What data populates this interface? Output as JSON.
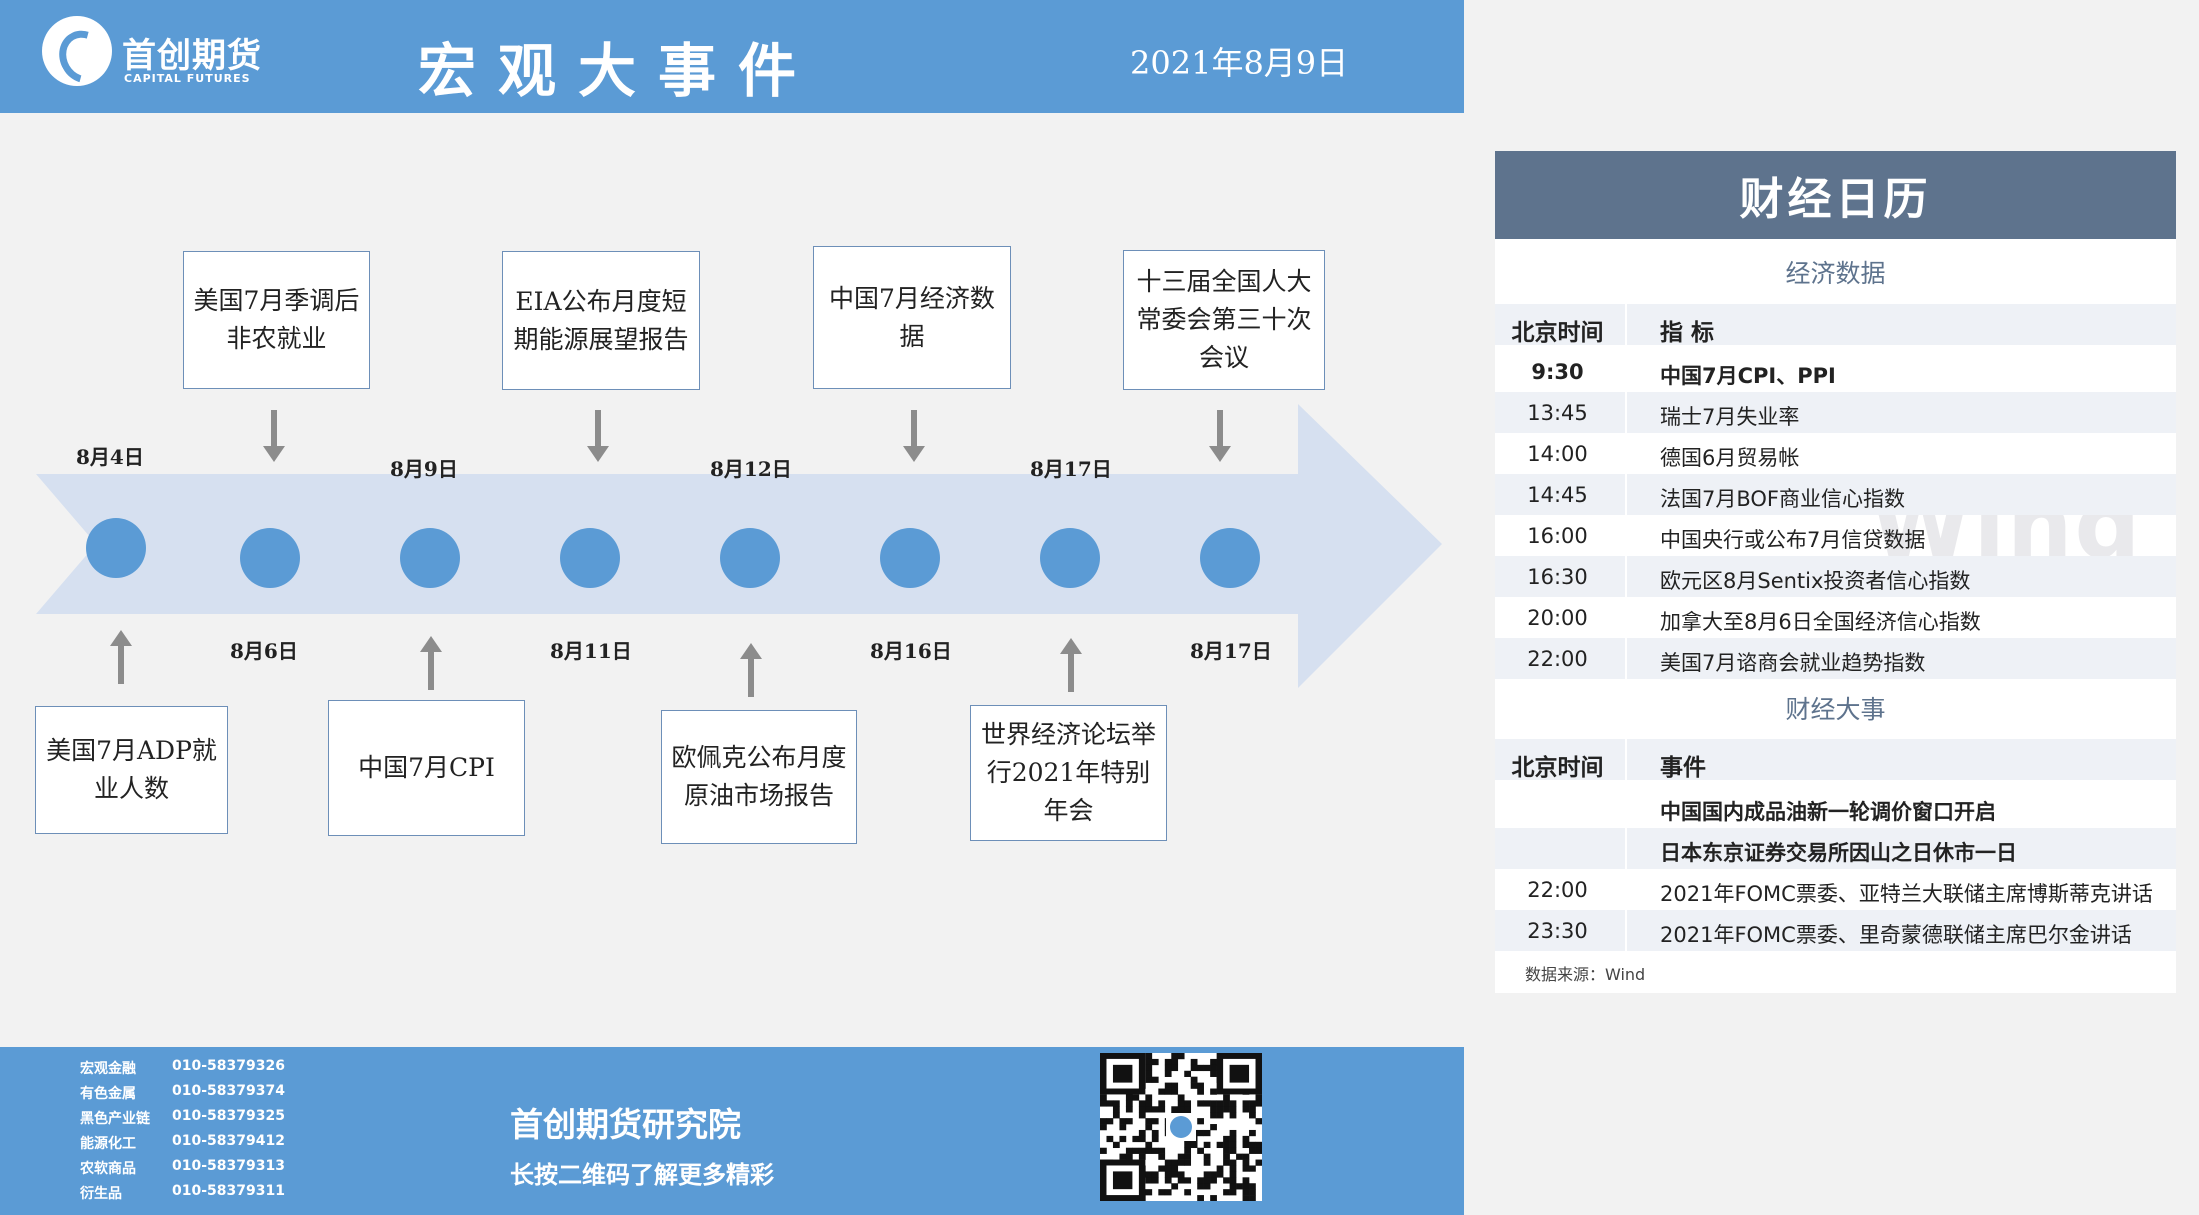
{
  "header": {
    "logo_cn": "首创期货",
    "logo_en": "CAPITAL FUTURES",
    "title": "宏观大事件",
    "date": "2021年8月9日"
  },
  "timeline": {
    "dates": [
      "8月4日",
      "8月6日",
      "8月9日",
      "8月11日",
      "8月12日",
      "8月16日",
      "8月17日",
      "8月17日"
    ],
    "events_top": [
      "美国7月季调后非农就业",
      "EIA公布月度短期能源展望报告",
      "中国7月经济数据",
      "十三届全国人大常委会第三十次会议"
    ],
    "events_bottom": [
      "美国7月ADP就业人数",
      "中国7月CPI",
      "欧佩克公布月度原油市场报告",
      "世界经济论坛举行2021年特别年会"
    ]
  },
  "calendar": {
    "title": "财经日历",
    "econ_section": "经济数据",
    "col_time": "北京时间",
    "col_indicator": "指 标",
    "econ_rows": [
      {
        "time": "9:30",
        "item": "中国7月CPI、PPI"
      },
      {
        "time": "13:45",
        "item": "瑞士7月失业率"
      },
      {
        "time": "14:00",
        "item": "德国6月贸易帐"
      },
      {
        "time": "14:45",
        "item": "法国7月BOF商业信心指数"
      },
      {
        "time": "16:00",
        "item": "中国央行或公布7月信贷数据"
      },
      {
        "time": "16:30",
        "item": "欧元区8月Sentix投资者信心指数"
      },
      {
        "time": "20:00",
        "item": "加拿大至8月6日全国经济信心指数"
      },
      {
        "time": "22:00",
        "item": "美国7月谘商会就业趋势指数"
      }
    ],
    "events_section": "财经大事",
    "col_event": "事件",
    "event_rows": [
      {
        "time": "",
        "item": "中国国内成品油新一轮调价窗口开启"
      },
      {
        "time": "",
        "item": "日本东京证券交易所因山之日休市一日"
      },
      {
        "time": "22:00",
        "item": "2021年FOMC票委、亚特兰大联储主席博斯蒂克讲话"
      },
      {
        "time": "23:30",
        "item": "2021年FOMC票委、里奇蒙德联储主席巴尔金讲话"
      }
    ],
    "watermark": "Wind",
    "source": "数据来源：Wind"
  },
  "footer": {
    "phones": [
      {
        "dept": "宏观金融",
        "tel": "010-58379326"
      },
      {
        "dept": "有色金属",
        "tel": "010-58379374"
      },
      {
        "dept": "黑色产业链",
        "tel": "010-58379325"
      },
      {
        "dept": "能源化工",
        "tel": "010-58379412"
      },
      {
        "dept": "农软商品",
        "tel": "010-58379313"
      },
      {
        "dept": "衍生品",
        "tel": "010-58379311"
      }
    ],
    "institute": "首创期货研究院",
    "slogan": "长按二维码了解更多精彩"
  },
  "colors": {
    "accent": "#5b9bd5",
    "calendar_header": "#5e738d",
    "arrow": "#d6e0f0"
  }
}
